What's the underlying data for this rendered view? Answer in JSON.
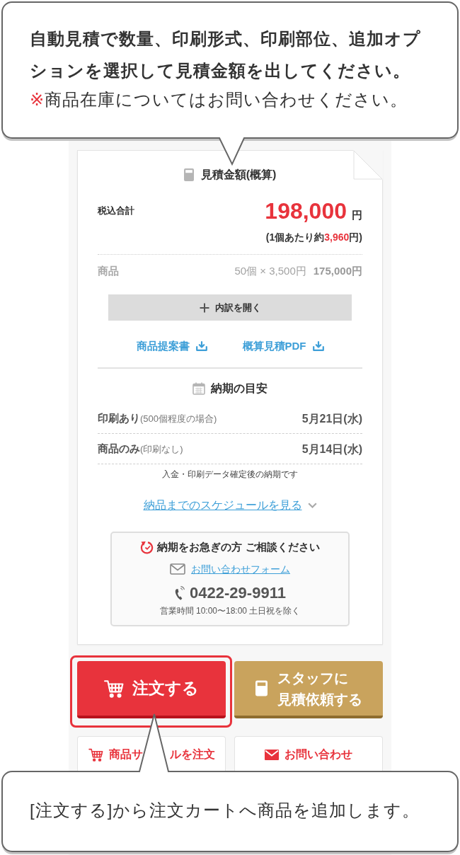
{
  "top_callout": {
    "instruction": "自動見積で数量、印刷形式、印刷部位、追加オプションを選択して見積金額を出してください。",
    "note": {
      "mark": "※",
      "text": "商品在庫についてはお問い合わせください。"
    }
  },
  "estimate": {
    "title": "見積金額(概算)",
    "total": {
      "label": "税込合計",
      "amount": "198,000",
      "unit": "円"
    },
    "per_unit": {
      "prefix": "(1個あたり約",
      "amount": "3,960",
      "suffix": "円)"
    },
    "items": [
      {
        "name": "商品",
        "quantity_price": "50個 × 3,500円",
        "subtotal": "175,000円"
      }
    ],
    "breakdown_button": "内訳を開く",
    "downloads": [
      {
        "label": "商品提案書"
      },
      {
        "label": "概算見積PDF"
      }
    ]
  },
  "delivery": {
    "title": "納期の目安",
    "rows": [
      {
        "label": "印刷あり",
        "note": "(500個程度の場合)",
        "date": "5月21日(水)"
      },
      {
        "label": "商品のみ",
        "note": "(印刷なし)",
        "date": "5月14日(水)"
      }
    ],
    "footnote": "入金・印刷データ確定後の納期です",
    "schedule_link": "納品までのスケジュールを見る"
  },
  "contact": {
    "heading": "納期をお急ぎの方 ご相談ください",
    "form_link": "お問い合わせフォーム",
    "phone": "0422-29-9911",
    "hours": "営業時間 10:00〜18:00 土日祝を除く"
  },
  "action_buttons": [
    {
      "kind": "order",
      "label_lines": [
        "注文する"
      ],
      "highlighted": true
    },
    {
      "kind": "quote",
      "label_lines": [
        "スタッフに",
        "見積依頼する"
      ],
      "highlighted": false
    }
  ],
  "secondary_buttons": [
    {
      "kind": "sample",
      "label_parts": [
        "商品サ",
        "ルを注文"
      ]
    },
    {
      "kind": "contact",
      "label_parts": [
        "お問い合わせ"
      ]
    }
  ],
  "bottom_callout": {
    "text": "[注文する]から注文カートへ商品を追加します。"
  }
}
